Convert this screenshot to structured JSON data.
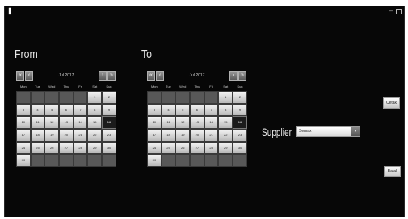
{
  "window": {
    "icon": "app-icon",
    "controls": {
      "minimize": "–"
    }
  },
  "from": {
    "heading": "From",
    "nav": {
      "first": "«",
      "prev": "‹",
      "next": "›",
      "last": "»"
    },
    "month": "Jul 2017",
    "weekdays": [
      "Mon",
      "Tue",
      "Wed",
      "Thu",
      "Fri",
      "Sat",
      "Sun"
    ],
    "days": [
      "",
      "",
      "",
      "",
      "",
      "1",
      "2",
      "3",
      "4",
      "5",
      "6",
      "7",
      "8",
      "9",
      "10",
      "11",
      "12",
      "13",
      "14",
      "15",
      "16",
      "17",
      "18",
      "19",
      "20",
      "21",
      "22",
      "23",
      "24",
      "25",
      "26",
      "27",
      "28",
      "29",
      "30",
      "31",
      "",
      "",
      "",
      "",
      "",
      ""
    ],
    "selected": "16"
  },
  "to": {
    "heading": "To",
    "nav": {
      "first": "«",
      "prev": "‹",
      "next": "›",
      "last": "»"
    },
    "month": "Jul 2017",
    "weekdays": [
      "Mon",
      "Tue",
      "Wed",
      "Thu",
      "Fri",
      "Sat",
      "Sun"
    ],
    "days": [
      "",
      "",
      "",
      "",
      "",
      "1",
      "2",
      "3",
      "4",
      "5",
      "6",
      "7",
      "8",
      "9",
      "10",
      "11",
      "12",
      "13",
      "14",
      "15",
      "16",
      "17",
      "18",
      "19",
      "20",
      "21",
      "22",
      "23",
      "24",
      "25",
      "26",
      "27",
      "28",
      "29",
      "30",
      "31",
      "",
      "",
      "",
      "",
      "",
      ""
    ],
    "selected": "16"
  },
  "supplier": {
    "label": "Supplier",
    "value": "Semax",
    "arrow": "▾"
  },
  "buttons": {
    "top": "Cetak",
    "bottom": "Batal"
  },
  "colors": {
    "background": "#070707",
    "day_cell": "#e6e6e6",
    "empty_cell": "#585858",
    "selected_cell": "#1b1b1b"
  }
}
